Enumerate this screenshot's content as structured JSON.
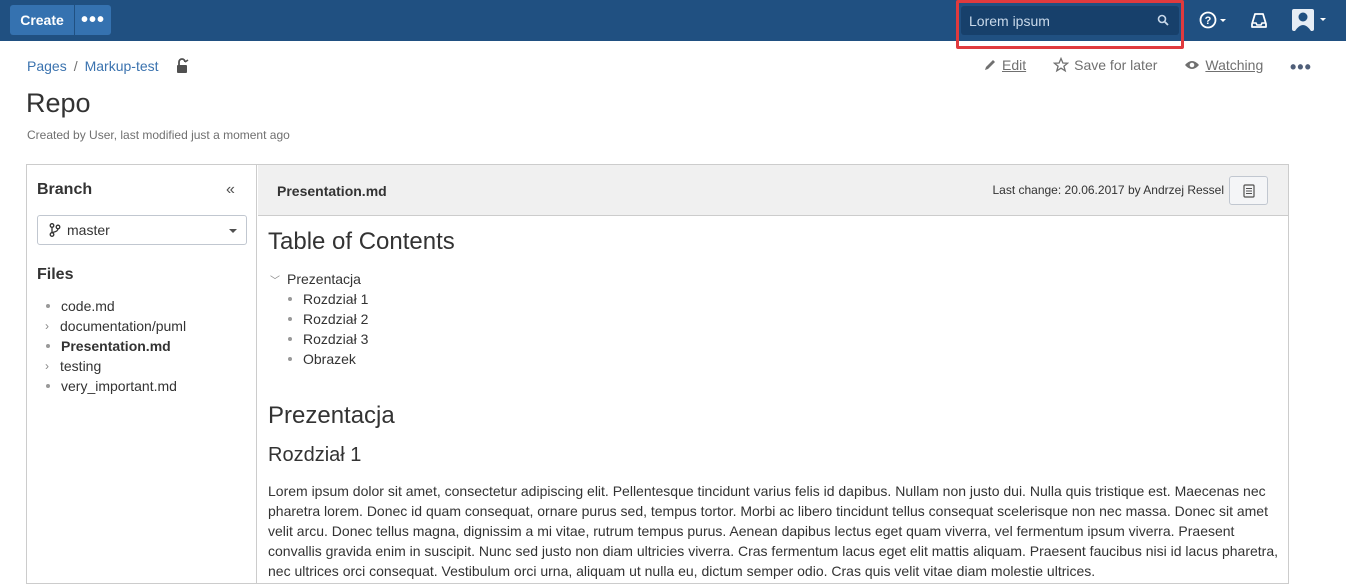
{
  "topbar": {
    "create_label": "Create",
    "more_label": "•••",
    "search_value": "Lorem ipsum",
    "colors": {
      "bar": "#205081",
      "button": "#3572b0",
      "highlight": "#e03a3e"
    }
  },
  "breadcrumb": {
    "items": [
      "Pages",
      "Markup-test"
    ],
    "separator": "/"
  },
  "actions": {
    "edit": "Edit",
    "save_for_later": "Save for later",
    "watching": "Watching",
    "more": "•••"
  },
  "page": {
    "title": "Repo",
    "meta": "Created by User, last modified just a moment ago"
  },
  "sidebar": {
    "branch_title": "Branch",
    "collapse": "«",
    "branch_value": "master",
    "files_title": "Files",
    "files": [
      {
        "name": "code.md",
        "kind": "file"
      },
      {
        "name": "documentation/puml",
        "kind": "folder"
      },
      {
        "name": "Presentation.md",
        "kind": "file-active"
      },
      {
        "name": "testing",
        "kind": "folder"
      },
      {
        "name": "very_important.md",
        "kind": "file"
      }
    ]
  },
  "content": {
    "file_name": "Presentation.md",
    "last_change_label": "Last change:",
    "last_change_date": "20.06.2017",
    "by_label": "by",
    "author": "Andrzej Ressel",
    "toc_title": "Table of Contents",
    "toc_root": "Prezentacja",
    "toc_items": [
      "Rozdział 1",
      "Rozdział 2",
      "Rozdział 3",
      "Obrazek"
    ],
    "heading1": "Prezentacja",
    "heading2": "Rozdział 1",
    "paragraph": "Lorem ipsum dolor sit amet, consectetur adipiscing elit. Pellentesque tincidunt varius felis id dapibus. Nullam non justo dui. Nulla quis tristique est. Maecenas nec pharetra lorem. Donec id quam consequat, ornare purus sed, tempus tortor. Morbi ac libero tincidunt tellus consequat scelerisque non nec massa. Donec sit amet velit arcu. Donec tellus magna, dignissim a mi vitae, rutrum tempus purus. Aenean dapibus lectus eget quam viverra, vel fermentum ipsum viverra. Praesent convallis gravida enim in suscipit. Nunc sed justo non diam ultricies viverra. Cras fermentum lacus eget elit mattis aliquam. Praesent faucibus nisi id lacus pharetra, nec ultrices orci consequat. Vestibulum orci urna, aliquam ut nulla eu, dictum semper odio. Cras quis velit vitae diam molestie ultrices."
  }
}
